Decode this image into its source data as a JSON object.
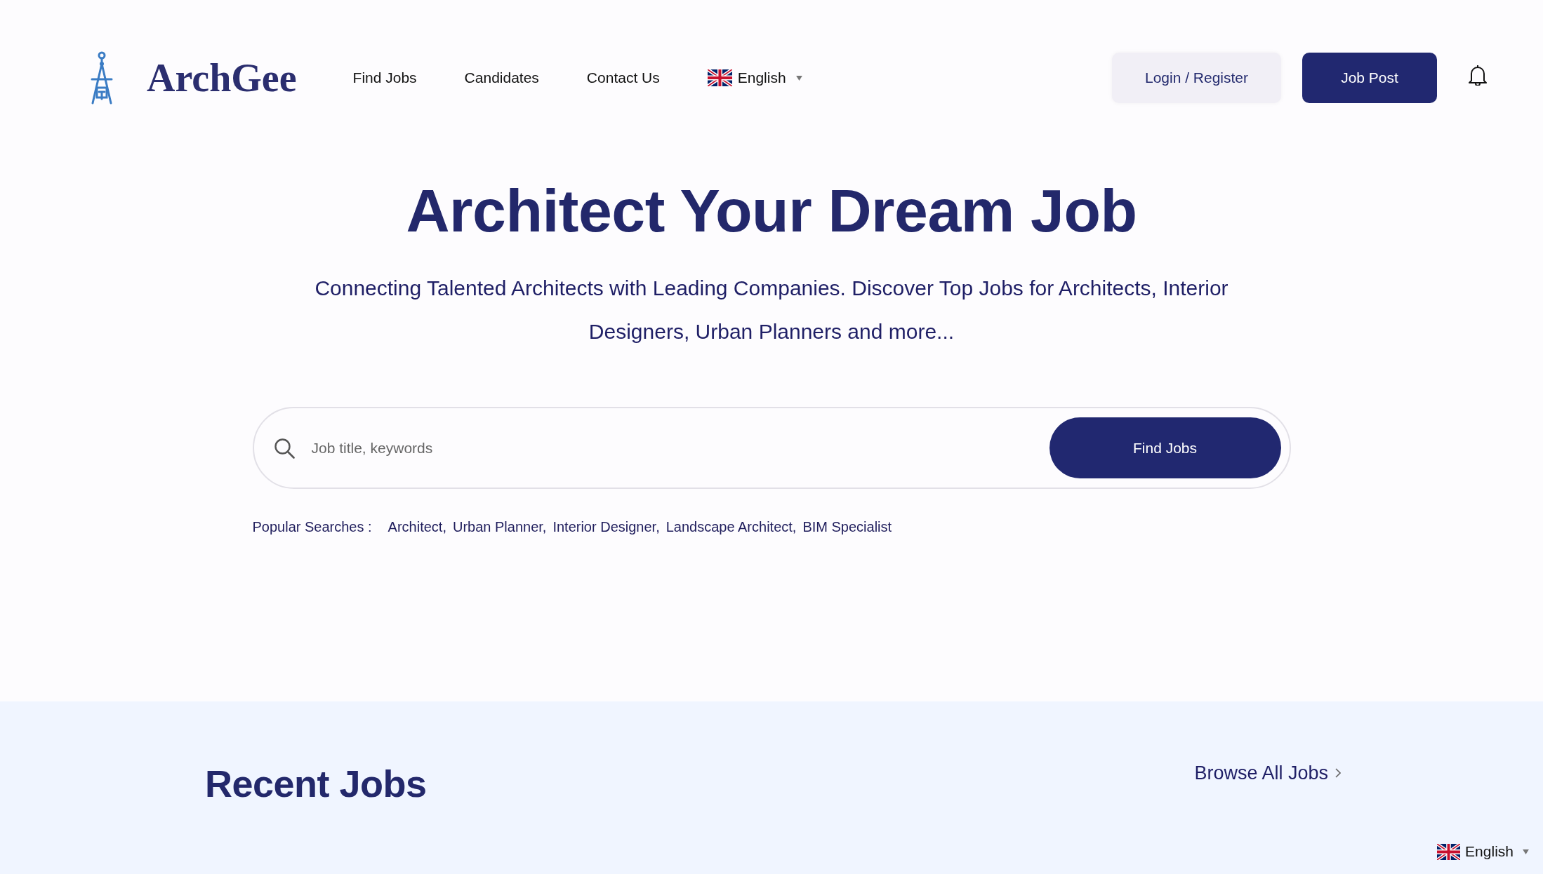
{
  "header": {
    "logo": {
      "text": "ArchGee"
    },
    "nav": [
      {
        "label": "Find Jobs"
      },
      {
        "label": "Candidates"
      },
      {
        "label": "Contact Us"
      }
    ],
    "language": {
      "label": "English"
    },
    "buttons": [
      {
        "kind": "secondary",
        "label": "Login / Register"
      },
      {
        "kind": "primary",
        "label": "Job Post"
      }
    ]
  },
  "hero": {
    "title": "Architect Your Dream Job",
    "subtitle": "Connecting Talented Architects with Leading Companies. Discover Top Jobs for Architects, Interior Designers, Urban Planners and more...",
    "search": {
      "placeholder": "Job title, keywords",
      "button": "Find Jobs"
    },
    "popular": {
      "label": "Popular Searches :",
      "items": [
        "Architect,",
        "Urban Planner,",
        "Interior Designer,",
        "Landscape Architect,",
        "BIM Specialist"
      ]
    }
  },
  "recent_jobs": {
    "title": "Recent Jobs",
    "browse_link": "Browse All Jobs"
  },
  "language_widget": {
    "label": "English"
  }
}
